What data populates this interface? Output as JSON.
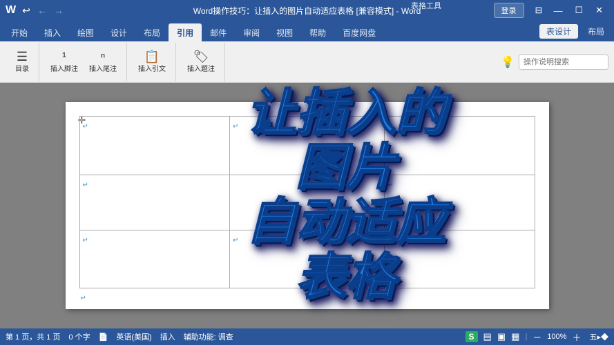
{
  "titlebar": {
    "title": "Word操作技巧：让插入的图片自动适应表格 [兼容模式] - Word",
    "app_name": "Word",
    "table_tools": "表格工具",
    "login": "登录",
    "nav_back": "←",
    "nav_forward": "→",
    "undo": "↩",
    "btn_minimize": "—",
    "btn_restore": "☐",
    "btn_close": "✕"
  },
  "ribbon": {
    "tabs": [
      {
        "label": "开始",
        "active": false
      },
      {
        "label": "插入",
        "active": false
      },
      {
        "label": "绘图",
        "active": false
      },
      {
        "label": "设计",
        "active": false
      },
      {
        "label": "布局",
        "active": false
      },
      {
        "label": "引用",
        "active": true
      },
      {
        "label": "邮件",
        "active": false
      },
      {
        "label": "审阅",
        "active": false
      },
      {
        "label": "视图",
        "active": false
      },
      {
        "label": "帮助",
        "active": false
      },
      {
        "label": "百度网盘",
        "active": false
      }
    ],
    "right_tabs": [
      {
        "label": "表设计",
        "active": false
      },
      {
        "label": "布局",
        "active": false
      }
    ],
    "search_placeholder": "操作说明搜索",
    "bulb": "💡"
  },
  "document": {
    "big_text": "让插入的\n图片\n自动适应\n表格",
    "table": {
      "rows": 3,
      "cols": 3
    },
    "move_cursor": "✛"
  },
  "statusbar": {
    "page_info": "第 1 页，共 1 页",
    "char_count": "0 个字",
    "doc_icon": "📄",
    "lang": "英语(美国)",
    "insert": "插入",
    "accessibility": "辅助功能: 调查",
    "s_logo": "S",
    "zoom": "五▸ ♦",
    "view_icons": [
      "▤",
      "▣",
      "▦"
    ]
  }
}
